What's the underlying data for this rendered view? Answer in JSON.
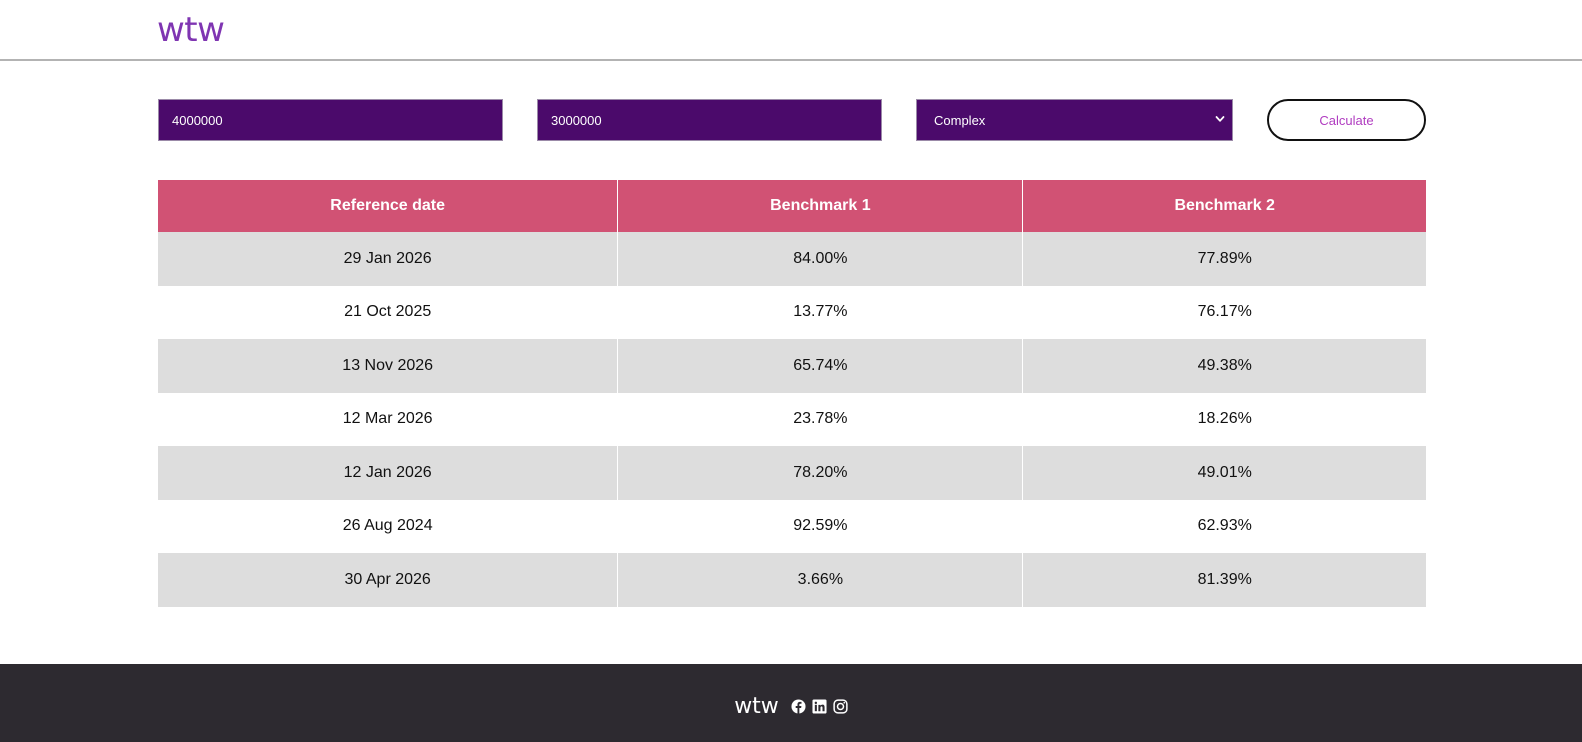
{
  "header": {
    "logo": "wtw"
  },
  "form": {
    "input1_value": "4000000",
    "input2_value": "3000000",
    "select_value": "Complex",
    "calculate_label": "Calculate"
  },
  "table": {
    "headers": [
      "Reference date",
      "Benchmark 1",
      "Benchmark 2"
    ],
    "rows": [
      [
        "29 Jan 2026",
        "84.00%",
        "77.89%"
      ],
      [
        "21 Oct 2025",
        "13.77%",
        "76.17%"
      ],
      [
        "13 Nov 2026",
        "65.74%",
        "49.38%"
      ],
      [
        "12 Mar 2026",
        "23.78%",
        "18.26%"
      ],
      [
        "12 Jan 2026",
        "78.20%",
        "49.01%"
      ],
      [
        "26 Aug 2024",
        "92.59%",
        "62.93%"
      ],
      [
        "30 Apr 2026",
        "3.66%",
        "81.39%"
      ]
    ]
  },
  "footer": {
    "logo": "wtw",
    "social_icons": [
      "facebook-icon",
      "linkedin-icon",
      "instagram-icon"
    ]
  },
  "colors": {
    "brand_purple": "#7f35b2",
    "input_bg": "#4b0a6b",
    "table_header": "#d15274",
    "row_stripe": "#dddddd",
    "footer_bg": "#2d2a30",
    "calculate_text": "#b03cc0"
  }
}
